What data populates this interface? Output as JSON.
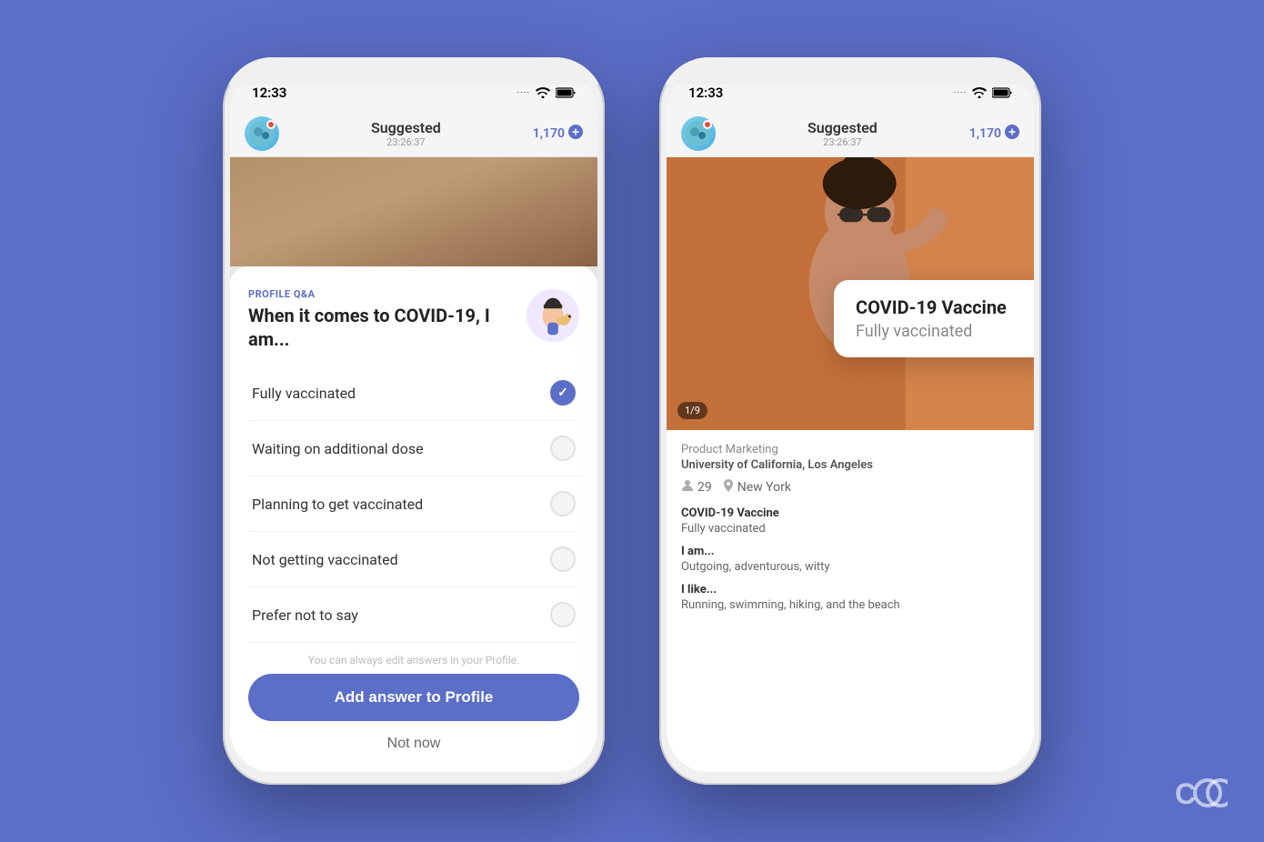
{
  "background_color": "#5B6EC8",
  "phone1": {
    "status": {
      "time": "12:33",
      "dots": "····",
      "wifi": "wifi",
      "battery": "battery"
    },
    "header": {
      "title": "Suggested",
      "subtitle": "23:26:37",
      "badge": "1,170"
    },
    "modal": {
      "qa_label": "PROFILE Q&A",
      "question": "When it comes to COVID-19, I am...",
      "edit_note": "You can always edit answers in your Profile.",
      "add_button": "Add answer to Profile",
      "not_now": "Not now",
      "options": [
        {
          "text": "Fully vaccinated",
          "selected": true
        },
        {
          "text": "Waiting on additional dose",
          "selected": false
        },
        {
          "text": "Planning to get vaccinated",
          "selected": false
        },
        {
          "text": "Not getting vaccinated",
          "selected": false
        },
        {
          "text": "Prefer not to say",
          "selected": false
        }
      ]
    }
  },
  "phone2": {
    "status": {
      "time": "12:33",
      "dots": "····",
      "wifi": "wifi",
      "battery": "battery"
    },
    "header": {
      "title": "Suggested",
      "subtitle": "23:26:37",
      "badge": "1,170"
    },
    "profile": {
      "photo_counter": "1/9",
      "job": "Product Marketing",
      "school": "University of California, Los Angeles",
      "age": "29",
      "location": "New York",
      "vaccine_label": "COVID-19 Vaccine",
      "vaccine_value": "Fully vaccinated",
      "iam_label": "I am...",
      "iam_value": "Outgoing, adventurous, witty",
      "ilike_label": "I like...",
      "ilike_value": "Running, swimming, hiking, and the beach"
    },
    "tooltip": {
      "title": "COVID-19 Vaccine",
      "value": "Fully vaccinated"
    }
  },
  "brand_logo": "CG3"
}
